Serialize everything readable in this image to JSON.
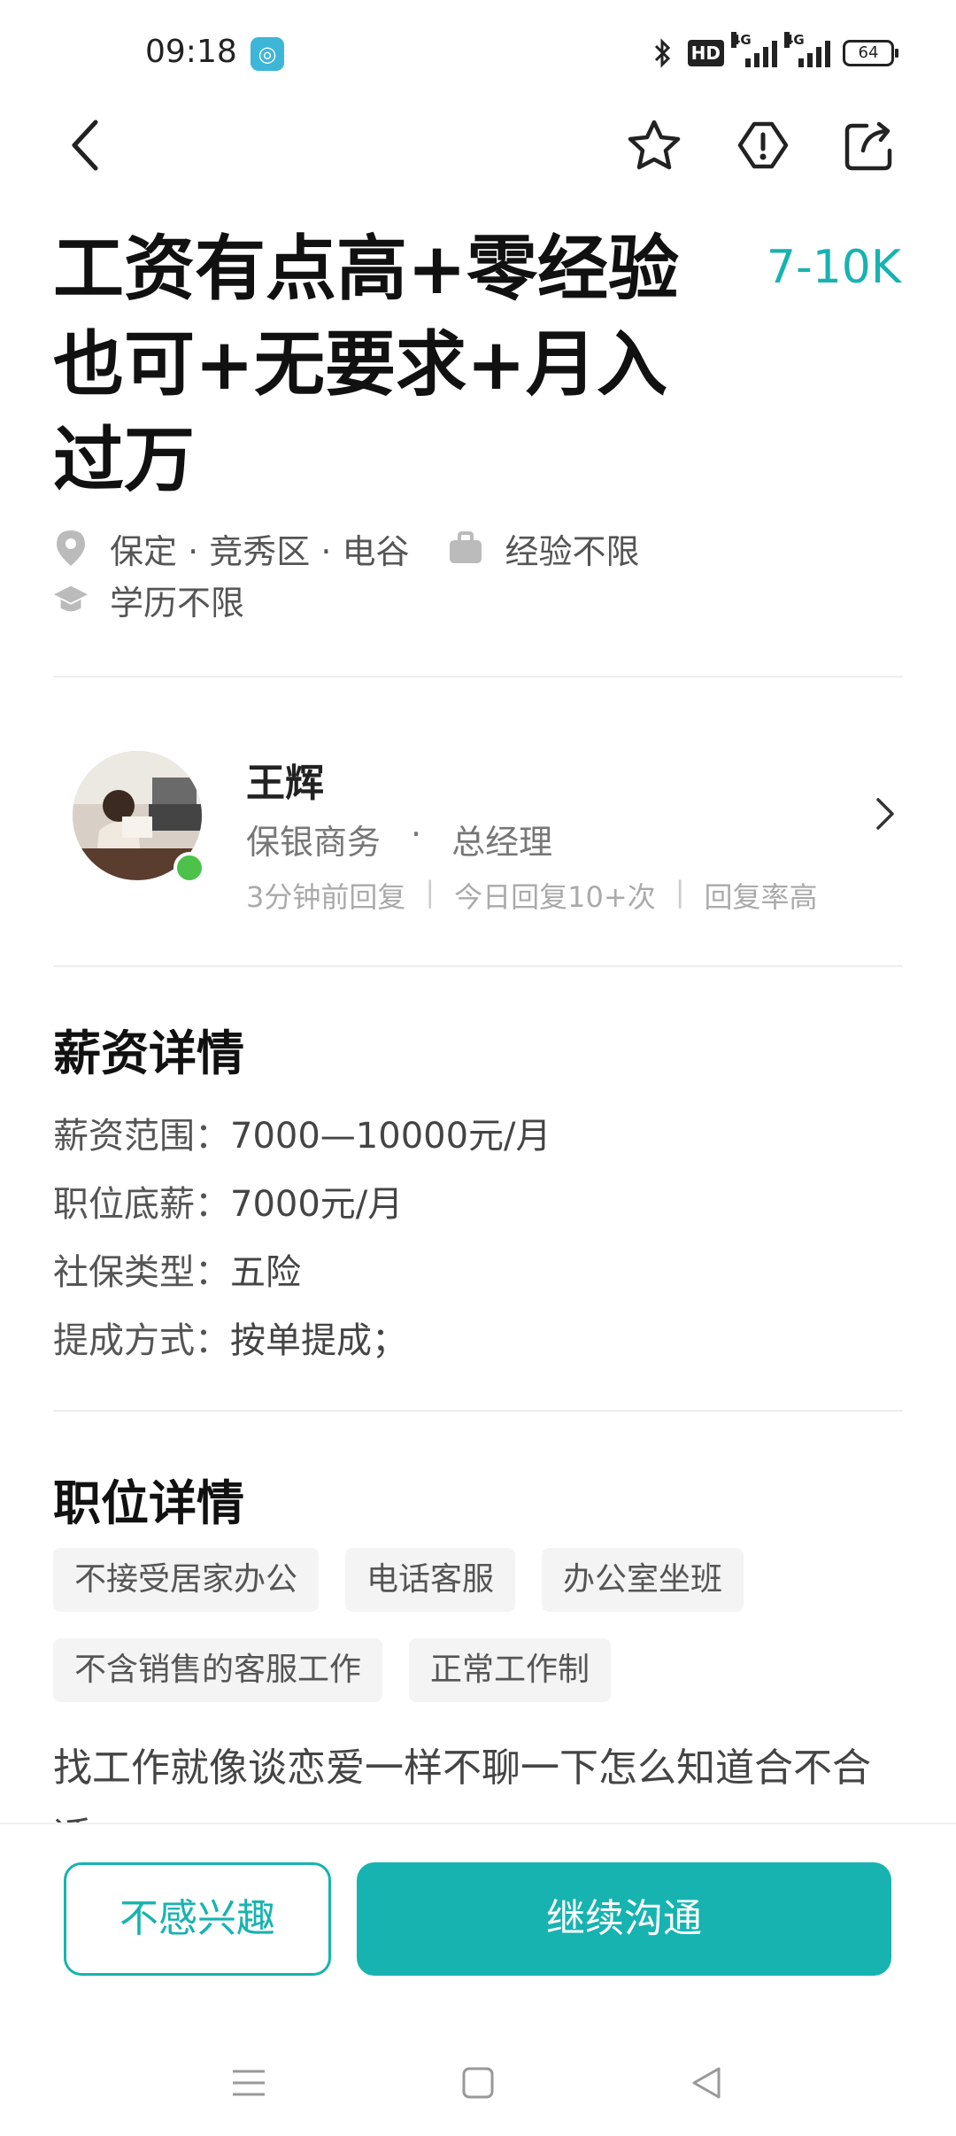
{
  "status_bar": {
    "time": "09:18",
    "hd_label": "HD",
    "net_1": "4G",
    "net_2": "4G",
    "battery": "64"
  },
  "job": {
    "title": "工资有点高+零经验也可+无要求+月入过万",
    "salary": "7-10K",
    "location": "保定 · 竞秀区 · 电谷",
    "experience": "经验不限",
    "education": "学历不限"
  },
  "recruiter": {
    "name": "王辉",
    "company": "保银商务",
    "dot": "·",
    "position": "总经理",
    "stat_1": "3分钟前回复",
    "stat_2": "今日回复10+次",
    "stat_3": "回复率高",
    "sep": "|"
  },
  "pay_details": {
    "heading": "薪资详情",
    "items": [
      {
        "label": "薪资范围：",
        "value": "7000—10000元/月"
      },
      {
        "label": "职位底薪：",
        "value": "7000元/月"
      },
      {
        "label": "社保类型：",
        "value": "五险"
      },
      {
        "label": "提成方式：",
        "value": "按单提成；"
      }
    ]
  },
  "job_details": {
    "heading": "职位详情",
    "tags": [
      "不接受居家办公",
      "电话客服",
      "办公室坐班",
      "不含销售的客服工作",
      "正常工作制"
    ],
    "description": "找工作就像谈恋爱一样不聊一下怎么知道合不合适"
  },
  "actions": {
    "not_interested": "不感兴趣",
    "continue_chat": "继续沟通"
  },
  "colors": {
    "accent": "#17b3b0",
    "online": "#4cc24a"
  }
}
